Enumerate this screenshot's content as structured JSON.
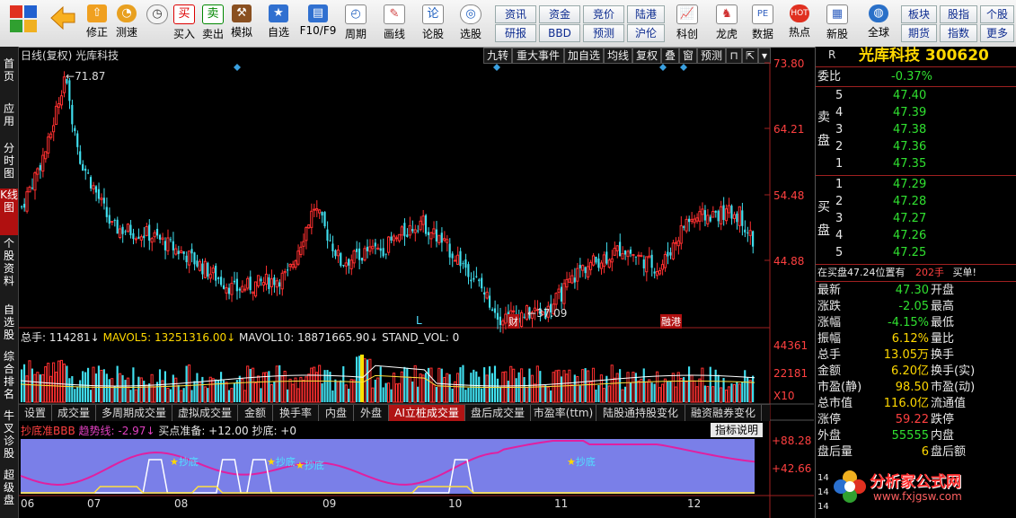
{
  "toolbar": {
    "buttons": [
      {
        "label": "",
        "icon": "logo-icon"
      },
      {
        "label": "",
        "icon": "back-icon"
      },
      {
        "label": "修正",
        "icon": "up-arrow-icon"
      },
      {
        "label": "测速",
        "icon": "speed-icon"
      },
      {
        "label": "买入",
        "icon": "buy-icon",
        "glyph": "买"
      },
      {
        "label": "卖出",
        "icon": "sell-icon",
        "glyph": "卖"
      },
      {
        "label": "模拟",
        "icon": "hammer-icon"
      },
      {
        "label": "自选",
        "icon": "star-icon"
      },
      {
        "label": "F10/F9",
        "icon": "f10-icon"
      },
      {
        "label": "周期",
        "icon": "clock-icon"
      },
      {
        "label": "画线",
        "icon": "pen-icon"
      },
      {
        "label": "论股",
        "icon": "chat-icon",
        "glyph": "论"
      },
      {
        "label": "选股",
        "icon": "select-icon"
      }
    ],
    "quick": [
      [
        "资讯",
        "资金",
        "竞价",
        "陆港"
      ],
      [
        "研报",
        "BBD",
        "预测",
        "沪伦"
      ]
    ],
    "icons2": [
      {
        "label": "科创",
        "icon": "chart-icon"
      },
      {
        "label": "龙虎",
        "icon": "tiger-icon"
      },
      {
        "label": "数据",
        "icon": "pe-icon",
        "glyph": "PE"
      },
      {
        "label": "热点",
        "icon": "hot-icon",
        "glyph": "HOT"
      },
      {
        "label": "新股",
        "icon": "newstock-icon"
      },
      {
        "label": "全球",
        "icon": "globe-icon"
      }
    ],
    "right_quick": [
      [
        "板块",
        "股指",
        "个股"
      ],
      [
        "期货",
        "指数",
        "更多"
      ]
    ]
  },
  "sidebar": [
    "首页",
    "应用",
    "分时图",
    "K线图",
    "个股资料",
    "自选股",
    "综合排名",
    "牛叉诊股",
    "超级盘"
  ],
  "chart": {
    "title": "日线(复权) 光库科技",
    "top_chips": [
      "九转",
      "重大事件",
      "加自选",
      "均线",
      "复权",
      "叠",
      "窗",
      "预测"
    ],
    "price_labels": [
      "73.80",
      "64.21",
      "54.48",
      "44.88"
    ],
    "high_mark": "71.87",
    "low_mark": "37.09",
    "event_marks": [
      "L",
      "财",
      "融港"
    ],
    "vol_header": {
      "total": "总手: 114281↓",
      "mavol5": "MAVOL5: 13251316.00↓",
      "mavol10": "MAVOL10: 18871665.90↓",
      "stand": "STAND_VOL: 0"
    },
    "vol_labels": [
      "44361",
      "22181",
      "X10"
    ],
    "tabs": [
      "设置",
      "成交量",
      "多周期成交量",
      "虚拟成交量",
      "金额",
      "换手率",
      "内盘",
      "外盘",
      "AI立桩成交量",
      "盘后成交量",
      "市盈率(ttm)",
      "陆股通持股变化",
      "融资融券变化"
    ],
    "active_tab": "AI立桩成交量",
    "ind_header": {
      "name": "抄底准BBB",
      "trend": "趋势线: -2.97↓",
      "buy": "买点准备: +12.00",
      "chao": "抄底: +0"
    },
    "ind_button": "指标说明",
    "ind_labels": [
      "+88.28",
      "+42.66"
    ],
    "ind_marks": [
      "抄底",
      "抄底",
      "抄底",
      "抄底"
    ],
    "x_labels": [
      "06",
      "07",
      "08",
      "09",
      "10",
      "11",
      "12"
    ]
  },
  "quote": {
    "flag": "R",
    "name": "光库科技 300620",
    "weibi_label": "委比",
    "weibi": "-0.37%",
    "sell_label": "卖盘",
    "buy_label": "买盘",
    "sells": [
      {
        "n": "5",
        "p": "47.40"
      },
      {
        "n": "4",
        "p": "47.39"
      },
      {
        "n": "3",
        "p": "47.38"
      },
      {
        "n": "2",
        "p": "47.36"
      },
      {
        "n": "1",
        "p": "47.35"
      }
    ],
    "buys": [
      {
        "n": "1",
        "p": "47.29"
      },
      {
        "n": "2",
        "p": "47.28"
      },
      {
        "n": "3",
        "p": "47.27"
      },
      {
        "n": "4",
        "p": "47.26"
      },
      {
        "n": "5",
        "p": "47.25"
      }
    ],
    "notice": "在买盘47.24位置有",
    "notice_hand": "202手",
    "notice_buy": "买单!",
    "stats": [
      {
        "k": "最新",
        "v": "47.30",
        "k2": "开盘"
      },
      {
        "k": "涨跌",
        "v": "-2.05",
        "k2": "最高"
      },
      {
        "k": "涨幅",
        "v": "-4.15%",
        "k2": "最低"
      },
      {
        "k": "振幅",
        "v": "6.12%",
        "k2": "量比"
      },
      {
        "k": "总手",
        "v": "13.05万",
        "k2": "换手"
      },
      {
        "k": "金额",
        "v": "6.20亿",
        "k2": "换手(实)"
      },
      {
        "k": "市盈(静)",
        "v": "98.50",
        "k2": "市盈(动)"
      },
      {
        "k": "总市值",
        "v": "116.0亿",
        "k2": "流通值"
      },
      {
        "k": "涨停",
        "v": "59.22",
        "k2": "跌停"
      },
      {
        "k": "外盘",
        "v": "55555",
        "k2": "内盘"
      },
      {
        "k": "盘后量",
        "v": "6",
        "k2": "盘后额"
      }
    ],
    "bottom_rows": [
      "14",
      "14",
      "14"
    ]
  },
  "watermark": {
    "cn": "分析家公式网",
    "url": "www.fxjgsw.com"
  },
  "colors": {
    "up": "#ff3030",
    "down": "#40e0f0",
    "accent": "#b01010"
  }
}
